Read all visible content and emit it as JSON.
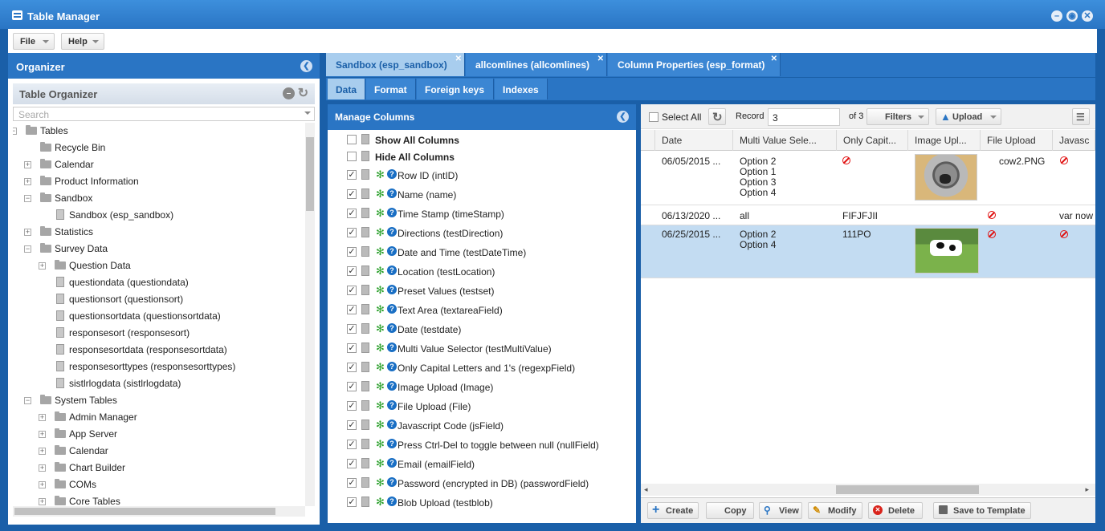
{
  "window": {
    "title": "Table Manager"
  },
  "menu": {
    "file": "File",
    "help": "Help"
  },
  "organizer": {
    "title": "Organizer",
    "panel_title": "Table Organizer",
    "search_placeholder": "Search",
    "tree": [
      {
        "label": "Tables",
        "type": "folder",
        "depth": 0,
        "expanded": true
      },
      {
        "label": "Recycle Bin",
        "type": "folder",
        "depth": 1
      },
      {
        "label": "Calendar",
        "type": "folder",
        "depth": 1,
        "collapsed": true
      },
      {
        "label": "Product Information",
        "type": "folder",
        "depth": 1,
        "collapsed": true
      },
      {
        "label": "Sandbox",
        "type": "folder",
        "depth": 1,
        "expanded": true
      },
      {
        "label": "Sandbox (esp_sandbox)",
        "type": "file",
        "depth": 2
      },
      {
        "label": "Statistics",
        "type": "folder",
        "depth": 1,
        "collapsed": true
      },
      {
        "label": "Survey Data",
        "type": "folder",
        "depth": 1,
        "expanded": true
      },
      {
        "label": "Question Data",
        "type": "folder",
        "depth": 2,
        "collapsed": true
      },
      {
        "label": "questiondata (questiondata)",
        "type": "file",
        "depth": 2
      },
      {
        "label": "questionsort (questionsort)",
        "type": "file",
        "depth": 2
      },
      {
        "label": "questionsortdata (questionsortdata)",
        "type": "file",
        "depth": 2
      },
      {
        "label": "responsesort (responsesort)",
        "type": "file",
        "depth": 2
      },
      {
        "label": "responsesortdata (responsesortdata)",
        "type": "file",
        "depth": 2
      },
      {
        "label": "responsesorttypes (responsesorttypes)",
        "type": "file",
        "depth": 2
      },
      {
        "label": "sistlrlogdata (sistlrlogdata)",
        "type": "file",
        "depth": 2
      },
      {
        "label": "System Tables",
        "type": "folder",
        "depth": 1,
        "expanded": true
      },
      {
        "label": "Admin Manager",
        "type": "folder",
        "depth": 2,
        "collapsed": true
      },
      {
        "label": "App Server",
        "type": "folder",
        "depth": 2,
        "collapsed": true
      },
      {
        "label": "Calendar",
        "type": "folder",
        "depth": 2,
        "collapsed": true
      },
      {
        "label": "Chart Builder",
        "type": "folder",
        "depth": 2,
        "collapsed": true
      },
      {
        "label": "COMs",
        "type": "folder",
        "depth": 2,
        "collapsed": true
      },
      {
        "label": "Core Tables",
        "type": "folder",
        "depth": 2,
        "collapsed": true
      }
    ]
  },
  "tabs": [
    {
      "label": "Sandbox (esp_sandbox)",
      "active": true
    },
    {
      "label": "allcomlines (allcomlines)",
      "active": false
    },
    {
      "label": "Column Properties (esp_format)",
      "active": false
    }
  ],
  "subtabs": [
    {
      "label": "Data",
      "active": true
    },
    {
      "label": "Format",
      "active": false
    },
    {
      "label": "Foreign keys",
      "active": false
    },
    {
      "label": "Indexes",
      "active": false
    }
  ],
  "manage_columns": {
    "title": "Manage Columns",
    "show_all": "Show All Columns",
    "hide_all": "Hide All Columns",
    "columns": [
      "Row ID (intID)",
      "Name (name)",
      "Time Stamp (timeStamp)",
      "Directions (testDirection)",
      "Date and Time (testDateTime)",
      "Location (testLocation)",
      "Preset Values (testset)",
      "Text Area (textareaField)",
      "Date (testdate)",
      "Multi Value Selector (testMultiValue)",
      "Only Capital Letters and 1's (regexpField)",
      "Image Upload (Image)",
      "File Upload (File)",
      "Javascript Code (jsField)",
      "Press Ctrl-Del to toggle between null (nullField)",
      "Email (emailField)",
      "Password (encrypted in DB) (passwordField)",
      "Blob Upload (testblob)"
    ]
  },
  "grid": {
    "select_all": "Select All",
    "record_label": "Record",
    "record_value": "3",
    "record_of": "of 3",
    "filters": "Filters",
    "upload": "Upload",
    "headers": [
      "Date",
      "Multi Value Sele...",
      "Only Capit...",
      "Image Upl...",
      "File Upload",
      "Javasc"
    ],
    "rows": [
      {
        "date": "06/05/2015 ...",
        "multi": [
          "Option 2",
          "Option 1",
          "Option 3",
          "Option 4"
        ],
        "caps": "",
        "file": "cow2.PNG",
        "js": ""
      },
      {
        "date": "06/13/2020 ...",
        "multi": [
          "all"
        ],
        "caps": "FIFJFJII",
        "file": "",
        "js": "var now"
      },
      {
        "date": "06/25/2015 ...",
        "multi": [
          "Option 2",
          "Option 4"
        ],
        "caps": "111PO",
        "file": "",
        "js": ""
      }
    ],
    "actions": {
      "create": "Create",
      "copy": "Copy",
      "view": "View",
      "modify": "Modify",
      "delete": "Delete",
      "save_template": "Save to Template"
    }
  },
  "colors": {
    "primary": "#2a75c4",
    "active_tab": "#a8cdee",
    "selected_row": "#c3dcf2",
    "null_icon": "#e01010"
  }
}
